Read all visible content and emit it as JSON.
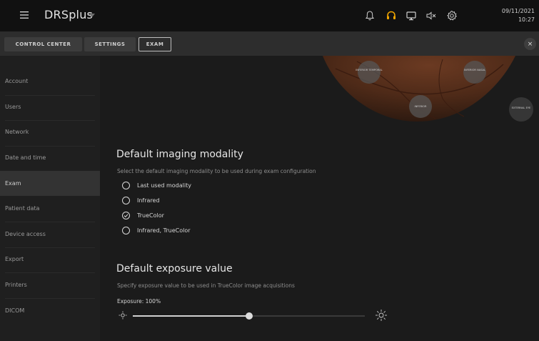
{
  "header": {
    "app_name": "DRSplus",
    "date": "09/11/2021",
    "time": "10:27",
    "accent_color": "#f0a500"
  },
  "tabs": [
    {
      "label": "CONTROL CENTER"
    },
    {
      "label": "SETTINGS"
    },
    {
      "label": "EXAM",
      "active": true
    }
  ],
  "tab_close_label": "×",
  "sidebar": {
    "items": [
      {
        "label": "Account"
      },
      {
        "label": "Users"
      },
      {
        "label": "Network"
      },
      {
        "label": "Date and time"
      },
      {
        "label": "Exam",
        "selected": true
      },
      {
        "label": "Patient data"
      },
      {
        "label": "Device access"
      },
      {
        "label": "Export"
      },
      {
        "label": "Printers"
      },
      {
        "label": "DICOM"
      }
    ]
  },
  "fundus_labels": {
    "inferior_temporal": "INFERIOR TEMPORAL",
    "inferior_nasal": "INFERIOR NASAL",
    "inferior": "INFERIOR",
    "external_eye": "EXTERNAL EYE"
  },
  "modality": {
    "title": "Default imaging modality",
    "description": "Select the default imaging modality to be used during exam configuration",
    "options": [
      {
        "label": "Last used modality",
        "checked": false
      },
      {
        "label": "Infrared",
        "checked": false
      },
      {
        "label": "TrueColor",
        "checked": true
      },
      {
        "label": "Infrared, TrueColor",
        "checked": false
      }
    ]
  },
  "exposure": {
    "title": "Default exposure value",
    "description": "Specify exposure value to be used in TrueColor image acquisitions",
    "label": "Exposure: 100%",
    "slider_fraction": 0.5
  }
}
